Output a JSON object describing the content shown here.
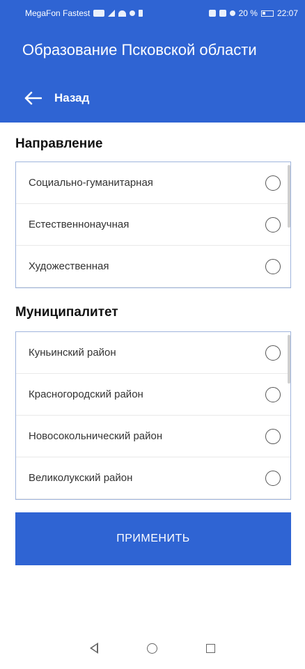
{
  "status_bar": {
    "carrier": "MegaFon Fastest",
    "battery": "20 %",
    "time": "22:07"
  },
  "app_bar": {
    "title": "Образование Псковской области"
  },
  "back_bar": {
    "label": "Назад"
  },
  "direction": {
    "title": "Направление",
    "options": [
      {
        "label": "Социально-гуманитарная",
        "selected": false
      },
      {
        "label": "Естественнонаучная",
        "selected": false
      },
      {
        "label": "Художественная",
        "selected": false
      }
    ]
  },
  "municipality": {
    "title": "Муниципалитет",
    "options": [
      {
        "label": "Куньинский район",
        "selected": false
      },
      {
        "label": "Красногородский район",
        "selected": false
      },
      {
        "label": "Новосокольнический район",
        "selected": false
      },
      {
        "label": "Великолукский район",
        "selected": false
      }
    ]
  },
  "apply_button": {
    "label": "ПРИМЕНИТЬ"
  },
  "colors": {
    "primary": "#2f64d3",
    "background": "#ffffff"
  }
}
